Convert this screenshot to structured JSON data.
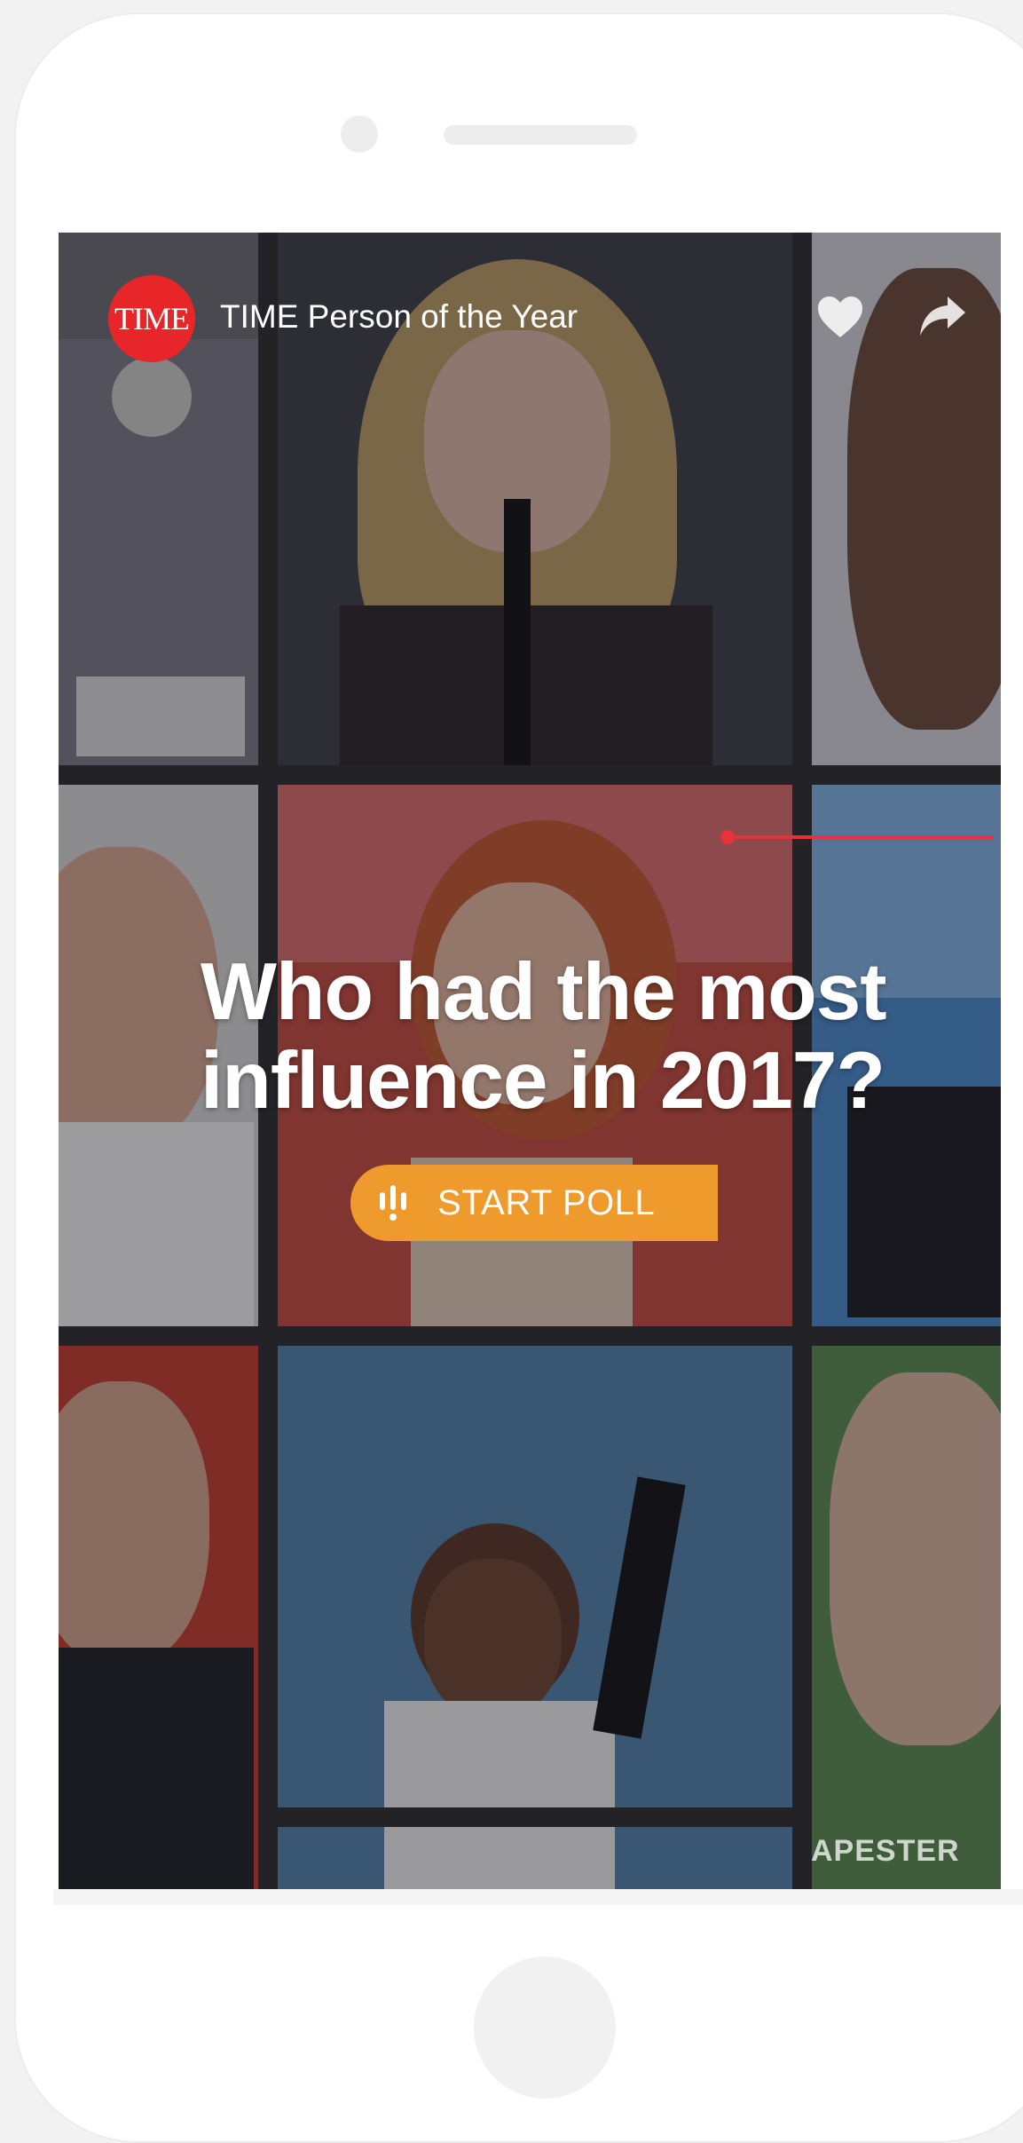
{
  "header": {
    "logo_text": "TIME",
    "channel_title": "TIME Person of the Year",
    "like_icon": "heart-icon",
    "share_icon": "share-icon"
  },
  "poll": {
    "question": "Who had the most influence in 2017?",
    "start_button_label": "START POLL",
    "start_button_icon": "poll-bars-icon"
  },
  "footer": {
    "brand_wordmark": "APESTER"
  },
  "colors": {
    "time_red": "#e8262a",
    "button_orange": "#ef9a2d",
    "pointer_red": "#e8323b"
  }
}
